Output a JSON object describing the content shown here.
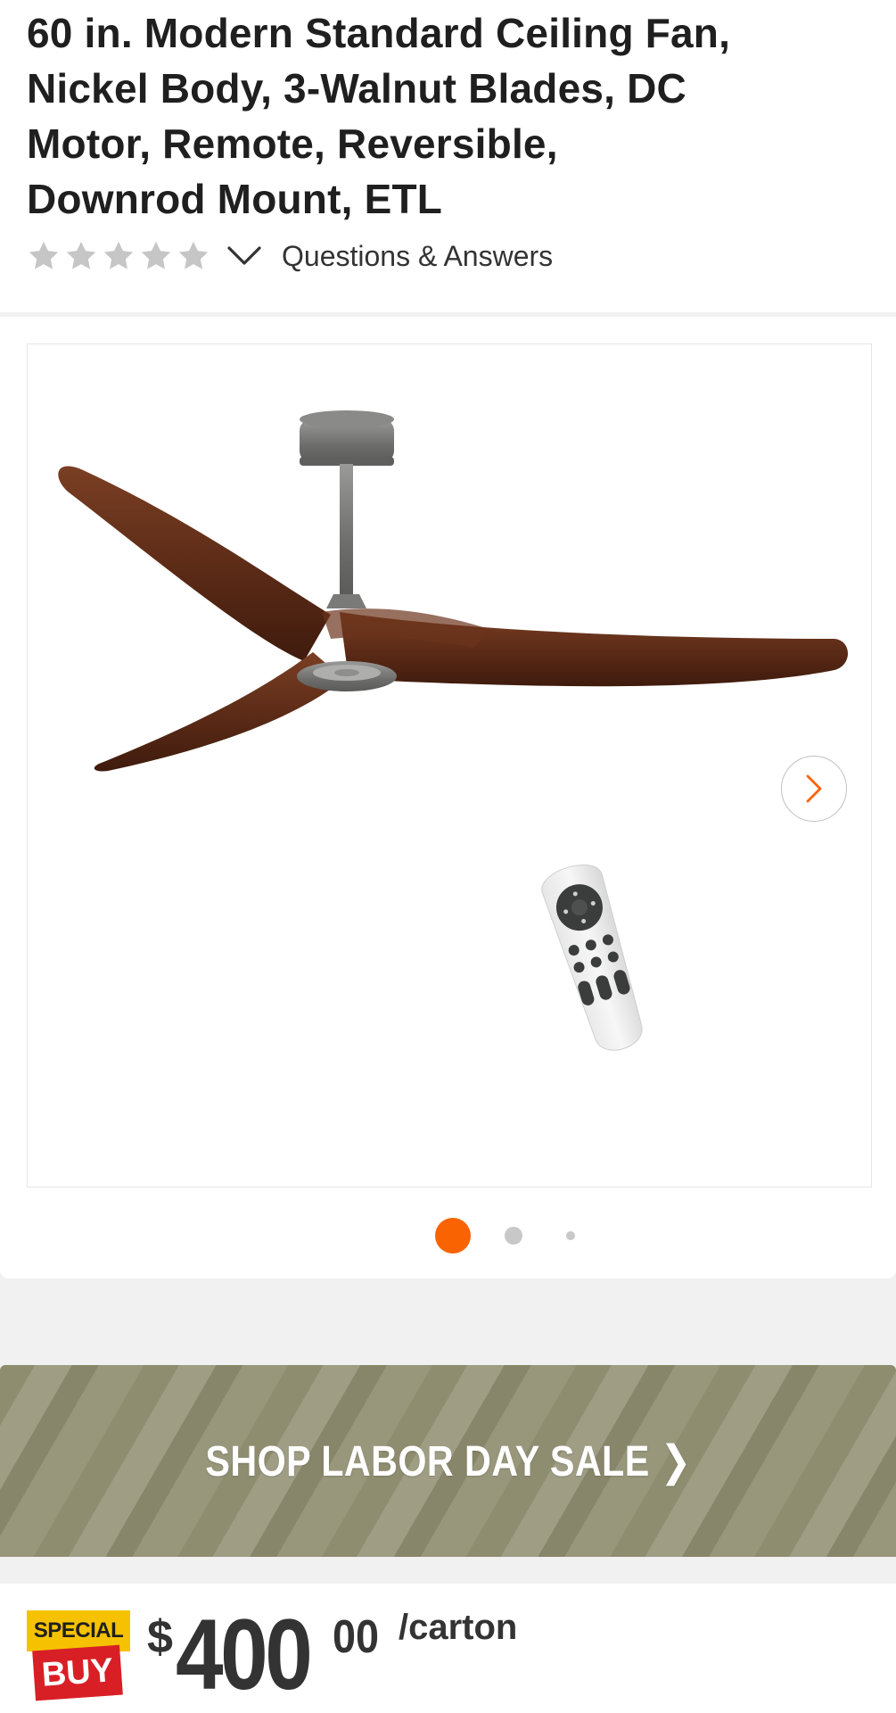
{
  "product": {
    "title": "60 in. Modern Standard Ceiling Fan, Nickel Body, 3-Walnut Blades, DC Motor, Remote, Reversible, Downrod Mount, ETL"
  },
  "rating": {
    "stars_filled": 0,
    "stars_total": 5,
    "star_color": "#c6c6c6",
    "qa_link_label": "Questions & Answers"
  },
  "gallery": {
    "image_count": 3,
    "active_index": 0,
    "active_dot_color": "#f96302",
    "inactive_dot_color": "#c8c8c8",
    "next_icon_color": "#f96302"
  },
  "promo": {
    "label": "SHOP LABOR DAY SALE ❯",
    "background_color": "#8f8d70"
  },
  "price": {
    "badge_top": "SPECIAL",
    "badge_bottom": "BUY",
    "badge_top_color": "#f6c200",
    "badge_bottom_color": "#d91f26",
    "currency": "$",
    "whole": "400",
    "cents": "00",
    "unit": "/carton"
  }
}
